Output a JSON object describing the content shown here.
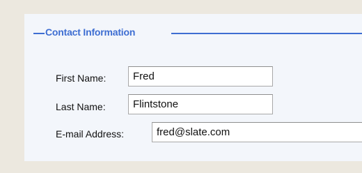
{
  "fieldset": {
    "legend": "Contact Information"
  },
  "fields": {
    "first_name": {
      "label": "First Name:",
      "value": "Fred"
    },
    "last_name": {
      "label": "Last Name:",
      "value": "Flintstone"
    },
    "email": {
      "label": "E-mail Address:",
      "value": "fred@slate.com"
    }
  },
  "colors": {
    "page_background": "#ece8df",
    "panel_background": "#f3f6fb",
    "legend_accent": "#3e6ed2",
    "input_border": "#a8a8a8"
  }
}
